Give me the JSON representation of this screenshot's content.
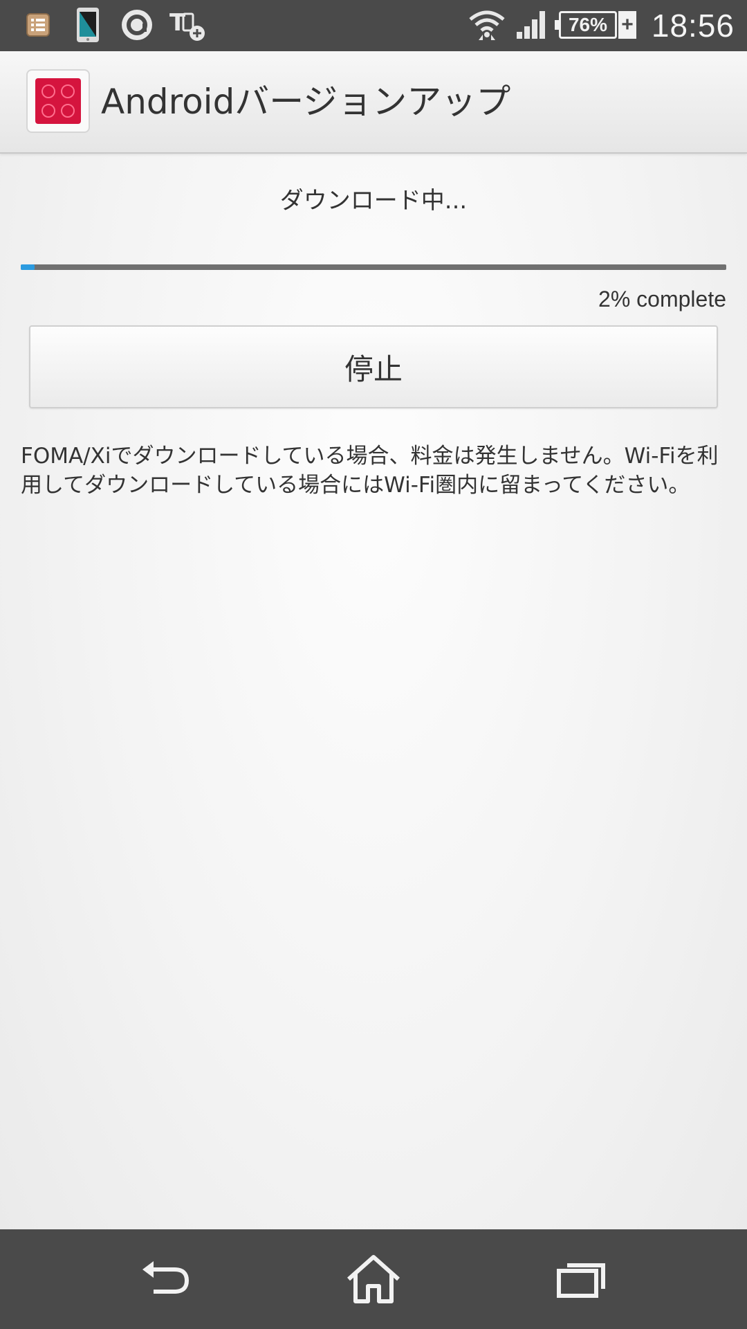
{
  "status_bar": {
    "time": "18:56",
    "battery_percent": "76%",
    "charging_symbol": "+",
    "icons": [
      "notification-list-icon",
      "phone-screen-icon",
      "circle-app-icon",
      "t-plus-app-icon",
      "wifi-icon",
      "signal-icon",
      "battery-icon"
    ]
  },
  "action_bar": {
    "title": "Androidバージョンアップ",
    "icon": "app-red-grid-icon",
    "icon_color": "#d5143e"
  },
  "download": {
    "status_label": "ダウンロード中...",
    "progress_fraction": 0.02,
    "progress_text": "2% complete",
    "progress_color": "#2b9be0"
  },
  "stop_button": {
    "label": "停止"
  },
  "notice": {
    "text": "FOMA/Xiでダウンロードしている場合、料金は発生しません。Wi-Fiを利用してダウンロードしている場合にはWi-Fi圏内に留まってください。"
  },
  "nav_bar": {
    "icons": [
      "back-icon",
      "home-icon",
      "recent-apps-icon"
    ]
  }
}
